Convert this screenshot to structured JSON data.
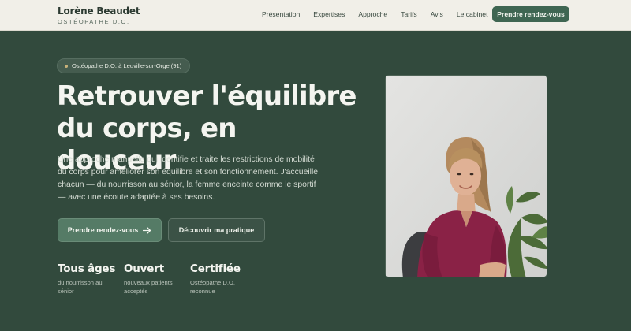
{
  "brand": {
    "name": "Lorène Beaudet",
    "subtitle": "OSTÉOPATHE D.O."
  },
  "nav": {
    "items": [
      "Présentation",
      "Expertises",
      "Approche",
      "Tarifs",
      "Avis",
      "Le cabinet"
    ],
    "cta": "Prendre rendez-vous"
  },
  "hero": {
    "badge": "Ostéopathe D.O. à Leuville-sur-Orge (91)",
    "title_line1": "Retrouver l'équilibre",
    "title_line2": "du corps, en douceur",
    "description": "Une approche manuelle qui identifie et traite les restrictions de mobilité du corps pour améliorer son équilibre et son fonctionnement. J'accueille chacun — du nourrisson au sénior, la femme enceinte comme le sportif — avec une écoute adaptée à ses besoins.",
    "primary_button": "Prendre rendez-vous",
    "secondary_button": "Découvrir ma pratique"
  },
  "stats": [
    {
      "title": "Tous âges",
      "line1": "du nourrisson au",
      "line2": "sénior"
    },
    {
      "title": "Ouvert",
      "line1": "nouveaux patients",
      "line2": "acceptés"
    },
    {
      "title": "Certifiée",
      "line1": "Ostéopathe D.O.",
      "line2": "reconnue"
    }
  ],
  "colors": {
    "background": "#324a3d",
    "topbar": "#f1efe8",
    "accent": "#3f6652",
    "badge_dot": "#c9b27a"
  }
}
